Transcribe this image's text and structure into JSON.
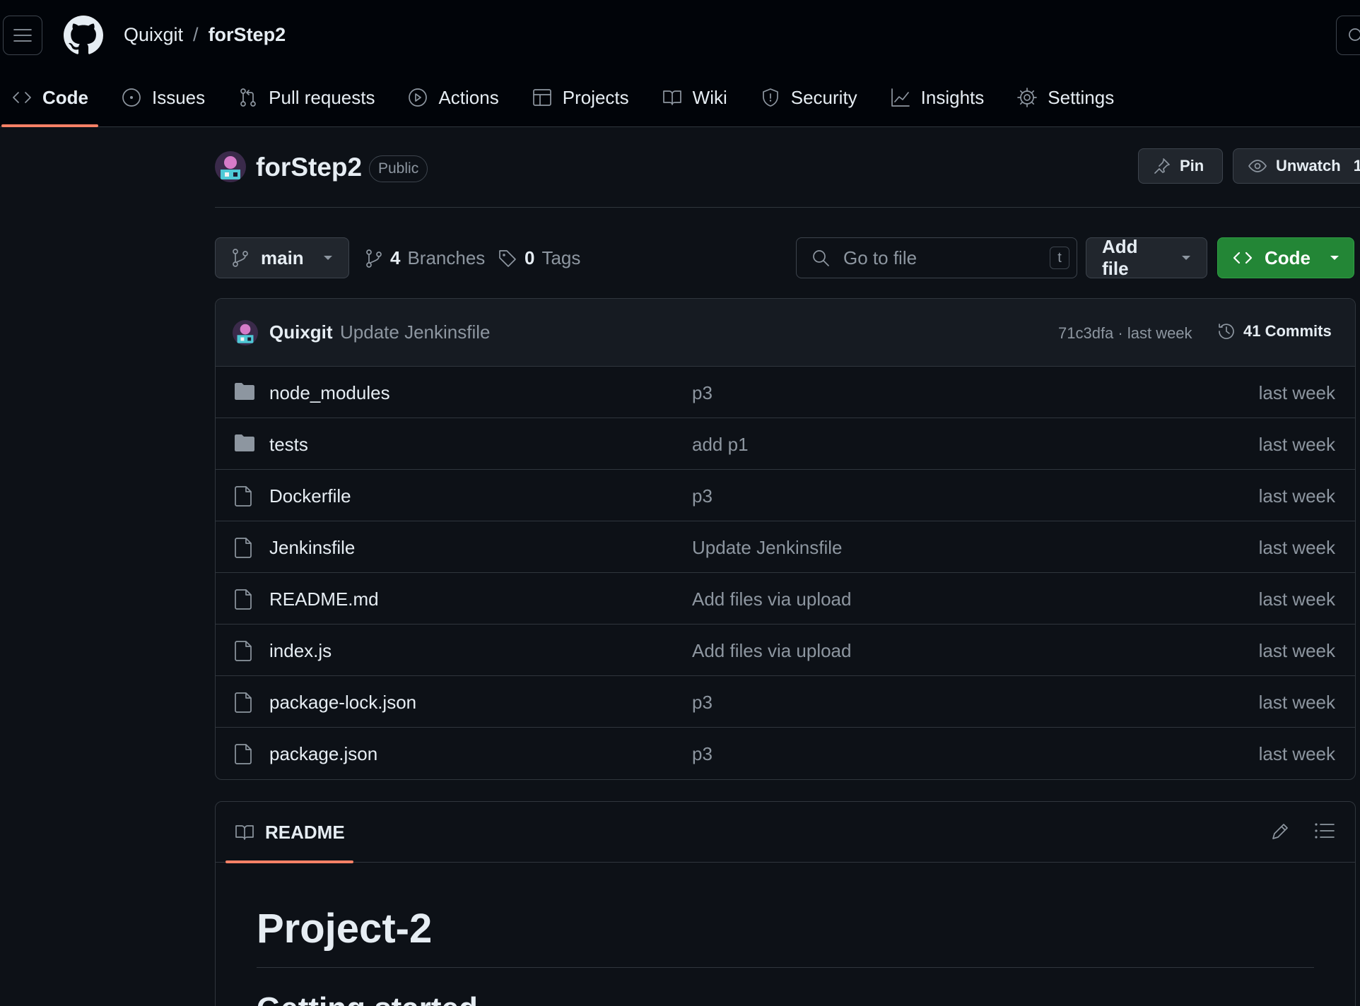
{
  "header": {
    "owner": "Quixgit",
    "separator": "/",
    "repo": "forStep2"
  },
  "tabs": [
    {
      "label": "Code",
      "icon": "code-icon",
      "active": true
    },
    {
      "label": "Issues",
      "icon": "issue-opened-icon"
    },
    {
      "label": "Pull requests",
      "icon": "git-pull-request-icon"
    },
    {
      "label": "Actions",
      "icon": "play-icon"
    },
    {
      "label": "Projects",
      "icon": "table-icon"
    },
    {
      "label": "Wiki",
      "icon": "book-icon"
    },
    {
      "label": "Security",
      "icon": "shield-icon"
    },
    {
      "label": "Insights",
      "icon": "graph-icon"
    },
    {
      "label": "Settings",
      "icon": "gear-icon"
    }
  ],
  "repo": {
    "name": "forStep2",
    "visibility": "Public",
    "pin_label": "Pin",
    "unwatch_label": "Unwatch",
    "watch_count": "1"
  },
  "toolbar": {
    "branch": "main",
    "branches_count": "4",
    "branches_label": "Branches",
    "tags_count": "0",
    "tags_label": "Tags",
    "goto_placeholder": "Go to file",
    "goto_shortcut": "t",
    "add_file_label": "Add file",
    "code_label": "Code"
  },
  "commit": {
    "author": "Quixgit",
    "message": "Update Jenkinsfile",
    "meta": "71c3dfa · last week",
    "commits_label": "41 Commits"
  },
  "files": [
    {
      "name": "node_modules",
      "type": "folder",
      "message": "p3",
      "time": "last week"
    },
    {
      "name": "tests",
      "type": "folder",
      "message": "add p1",
      "time": "last week"
    },
    {
      "name": "Dockerfile",
      "type": "file",
      "message": "p3",
      "time": "last week"
    },
    {
      "name": "Jenkinsfile",
      "type": "file",
      "message": "Update Jenkinsfile",
      "time": "last week"
    },
    {
      "name": "README.md",
      "type": "file",
      "message": "Add files via upload",
      "time": "last week"
    },
    {
      "name": "index.js",
      "type": "file",
      "message": "Add files via upload",
      "time": "last week"
    },
    {
      "name": "package-lock.json",
      "type": "file",
      "message": "p3",
      "time": "last week"
    },
    {
      "name": "package.json",
      "type": "file",
      "message": "p3",
      "time": "last week"
    }
  ],
  "readme": {
    "tab_label": "README",
    "title": "Project-2",
    "subheading": "Getting started"
  },
  "colors": {
    "background": "#0d1117",
    "header_bg": "#010409",
    "accent_underline": "#f78166",
    "code_button": "#238636",
    "muted_text": "#8d96a0"
  }
}
